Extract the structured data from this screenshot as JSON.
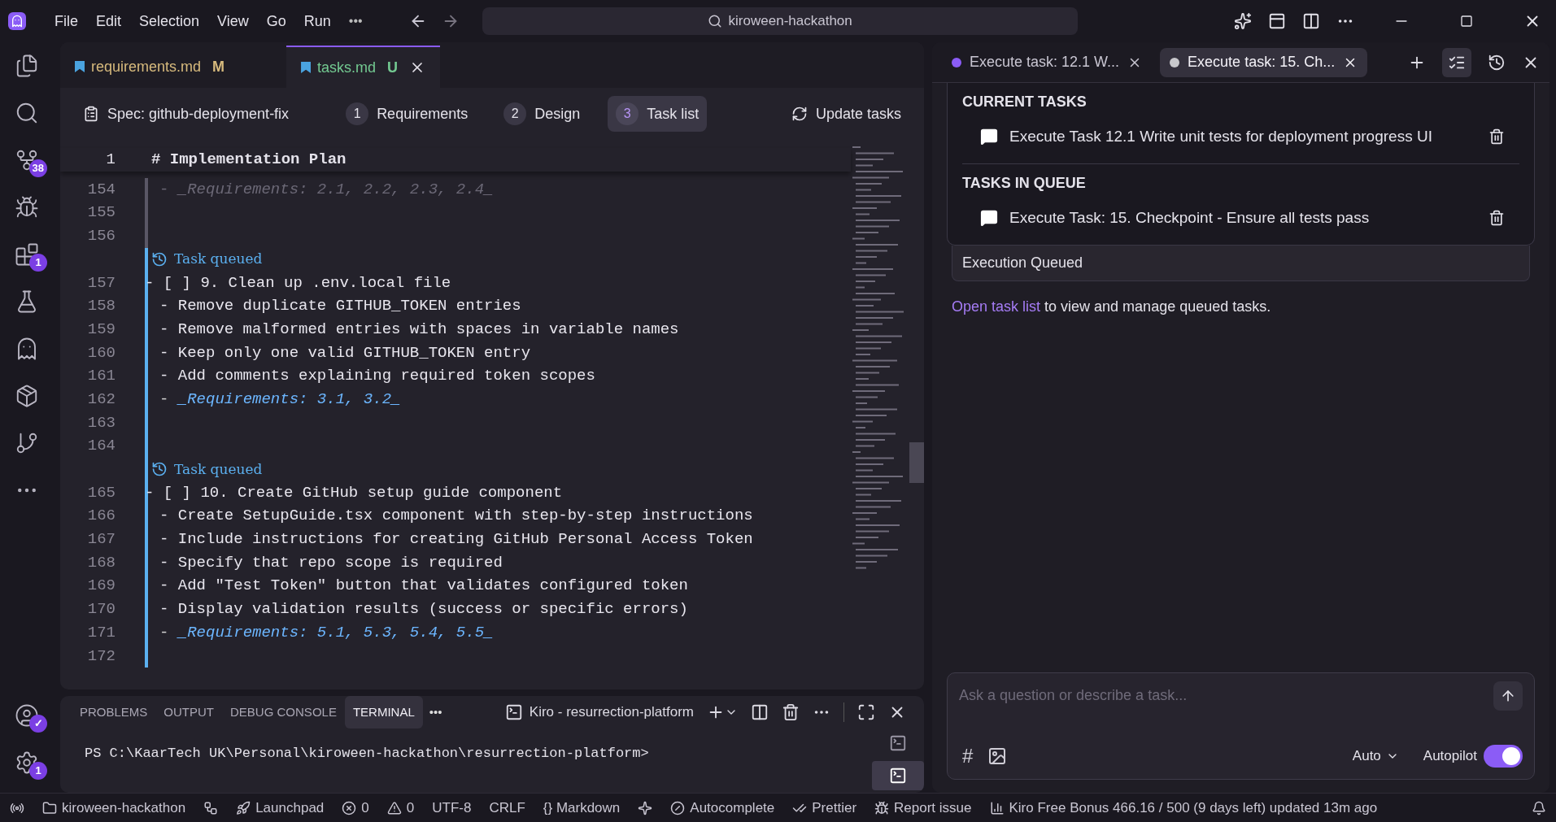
{
  "title_bar": {
    "menus": [
      "File",
      "Edit",
      "Selection",
      "View",
      "Go",
      "Run"
    ],
    "more": "•••",
    "search": "kiroween-hackathon"
  },
  "activity_bar": {
    "items": [
      {
        "kind": "files"
      },
      {
        "kind": "search"
      },
      {
        "kind": "source",
        "badge": "38"
      },
      {
        "kind": "debug"
      },
      {
        "kind": "extensions",
        "badge": "1"
      },
      {
        "kind": "flask"
      },
      {
        "kind": "ghost"
      },
      {
        "kind": "package"
      },
      {
        "kind": "graph"
      },
      {
        "kind": "more"
      }
    ],
    "bottom": [
      {
        "kind": "account",
        "badge": "✓"
      },
      {
        "kind": "settings",
        "badge": "1"
      }
    ]
  },
  "editor_tabs": [
    {
      "label": "requirements.md",
      "status": "M",
      "color": "#d7ba7d",
      "selected": false
    },
    {
      "label": "tasks.md",
      "status": "U",
      "color": "#73c991",
      "selected": true
    }
  ],
  "spec_bar": {
    "title": "Spec: github-deployment-fix",
    "steps": [
      {
        "number": "1",
        "label": "Requirements",
        "selected": false
      },
      {
        "number": "2",
        "label": "Design",
        "selected": false
      },
      {
        "number": "3",
        "label": "Task list",
        "selected": true
      }
    ],
    "update": "Update tasks"
  },
  "editor": {
    "sticky": {
      "number": "1",
      "text": "# Implementation Plan"
    },
    "blocks": [
      {
        "queued": false,
        "lines": [
          {
            "number": "154",
            "kind": "req",
            "text": "- *_Requirements: 2.1, 2.2, 2.3, 2.4_*"
          },
          {
            "number": "155",
            "kind": "blank"
          },
          {
            "number": "156",
            "kind": "blank"
          }
        ]
      },
      {
        "queued": true,
        "label": "Task queued",
        "lines": [
          {
            "number": "157",
            "kind": "task",
            "text": "- [ ] 9. Clean up .env.local file"
          },
          {
            "number": "158",
            "kind": "bullet",
            "text": "- Remove duplicate GITHUB_TOKEN entries"
          },
          {
            "number": "159",
            "kind": "bullet",
            "text": "- Remove malformed entries with spaces in variable names"
          },
          {
            "number": "160",
            "kind": "bullet",
            "text": "- Keep only one valid GITHUB_TOKEN entry"
          },
          {
            "number": "161",
            "kind": "bullet",
            "text": "- Add comments explaining required token scopes"
          },
          {
            "number": "162",
            "kind": "req",
            "text": "- *_Requirements: 3.1, 3.2_*"
          },
          {
            "number": "163",
            "kind": "blank"
          },
          {
            "number": "164",
            "kind": "blank"
          }
        ]
      },
      {
        "queued": true,
        "label": "Task queued",
        "lines": [
          {
            "number": "165",
            "kind": "task",
            "text": "- [ ] 10. Create GitHub setup guide component"
          },
          {
            "number": "166",
            "kind": "bullet",
            "text": "- Create SetupGuide.tsx component with step-by-step instructions"
          },
          {
            "number": "167",
            "kind": "bullet",
            "text": "- Include instructions for creating GitHub Personal Access Token"
          },
          {
            "number": "168",
            "kind": "bullet",
            "text": "- Specify that repo scope is required"
          },
          {
            "number": "169",
            "kind": "bullet",
            "text": "- Add \"Test Token\" button that validates configured token"
          },
          {
            "number": "170",
            "kind": "bullet",
            "text": "- Display validation results (success or specific errors)"
          },
          {
            "number": "171",
            "kind": "req",
            "text": "- *_Requirements: 5.1, 5.3, 5.4, 5.5_*"
          },
          {
            "number": "172",
            "kind": "blank"
          }
        ]
      }
    ]
  },
  "panel": {
    "tabs": [
      {
        "label": "PROBLEMS",
        "selected": false
      },
      {
        "label": "OUTPUT",
        "selected": false
      },
      {
        "label": "DEBUG CONSOLE",
        "selected": false
      },
      {
        "label": "TERMINAL",
        "selected": true
      }
    ],
    "more": "•••",
    "terminal_name": "Kiro - resurrection-platform",
    "prompt": "PS C:\\KaarTech UK\\Personal\\kiroween-hackathon\\resurrection-platform>",
    "sessions": [
      {
        "selected": false
      },
      {
        "selected": true
      }
    ]
  },
  "chat": {
    "tabs": [
      {
        "label": "Execute task: 12.1 W...",
        "color": "#8b5cf6",
        "selected": false
      },
      {
        "label": "Execute task: 15. Ch...",
        "color": "#c8c8cc",
        "selected": true
      }
    ],
    "sections": [
      {
        "heading": "CURRENT TASKS",
        "tasks": [
          "Execute Task 12.1 Write unit tests for deployment progress UI"
        ]
      },
      {
        "heading": "TASKS IN QUEUE",
        "tasks": [
          "Execute Task: 15. Checkpoint - Ensure all tests pass"
        ]
      }
    ],
    "status": "Execution Queued",
    "link": "Open task list",
    "note": "to view and manage queued tasks.",
    "input": {
      "placeholder": "Ask a question or describe a task...",
      "model": "Auto",
      "autopilot_label": "Autopilot",
      "autopilot": true,
      "hash": "#"
    }
  },
  "status_bar": [
    {
      "kind": "remote"
    },
    {
      "kind": "folder",
      "text": "kiroween-hackathon"
    },
    {
      "kind": "branch"
    },
    {
      "kind": "launch",
      "text": "Launchpad"
    },
    {
      "kind": "errors",
      "text": "0"
    },
    {
      "kind": "warnings",
      "text": "0"
    },
    {
      "kind": "plain",
      "text": "UTF-8"
    },
    {
      "kind": "plain",
      "text": "CRLF"
    },
    {
      "kind": "plain",
      "text": "{}  Markdown"
    },
    {
      "kind": "sparkle"
    },
    {
      "kind": "autocomplete",
      "text": "Autocomplete"
    },
    {
      "kind": "prettier",
      "text": "Prettier"
    },
    {
      "kind": "bug",
      "text": "Report issue"
    },
    {
      "kind": "usage",
      "text": "Kiro Free Bonus 466.16 / 500 (9 days left) updated 13m ago"
    },
    {
      "kind": "bell"
    }
  ]
}
